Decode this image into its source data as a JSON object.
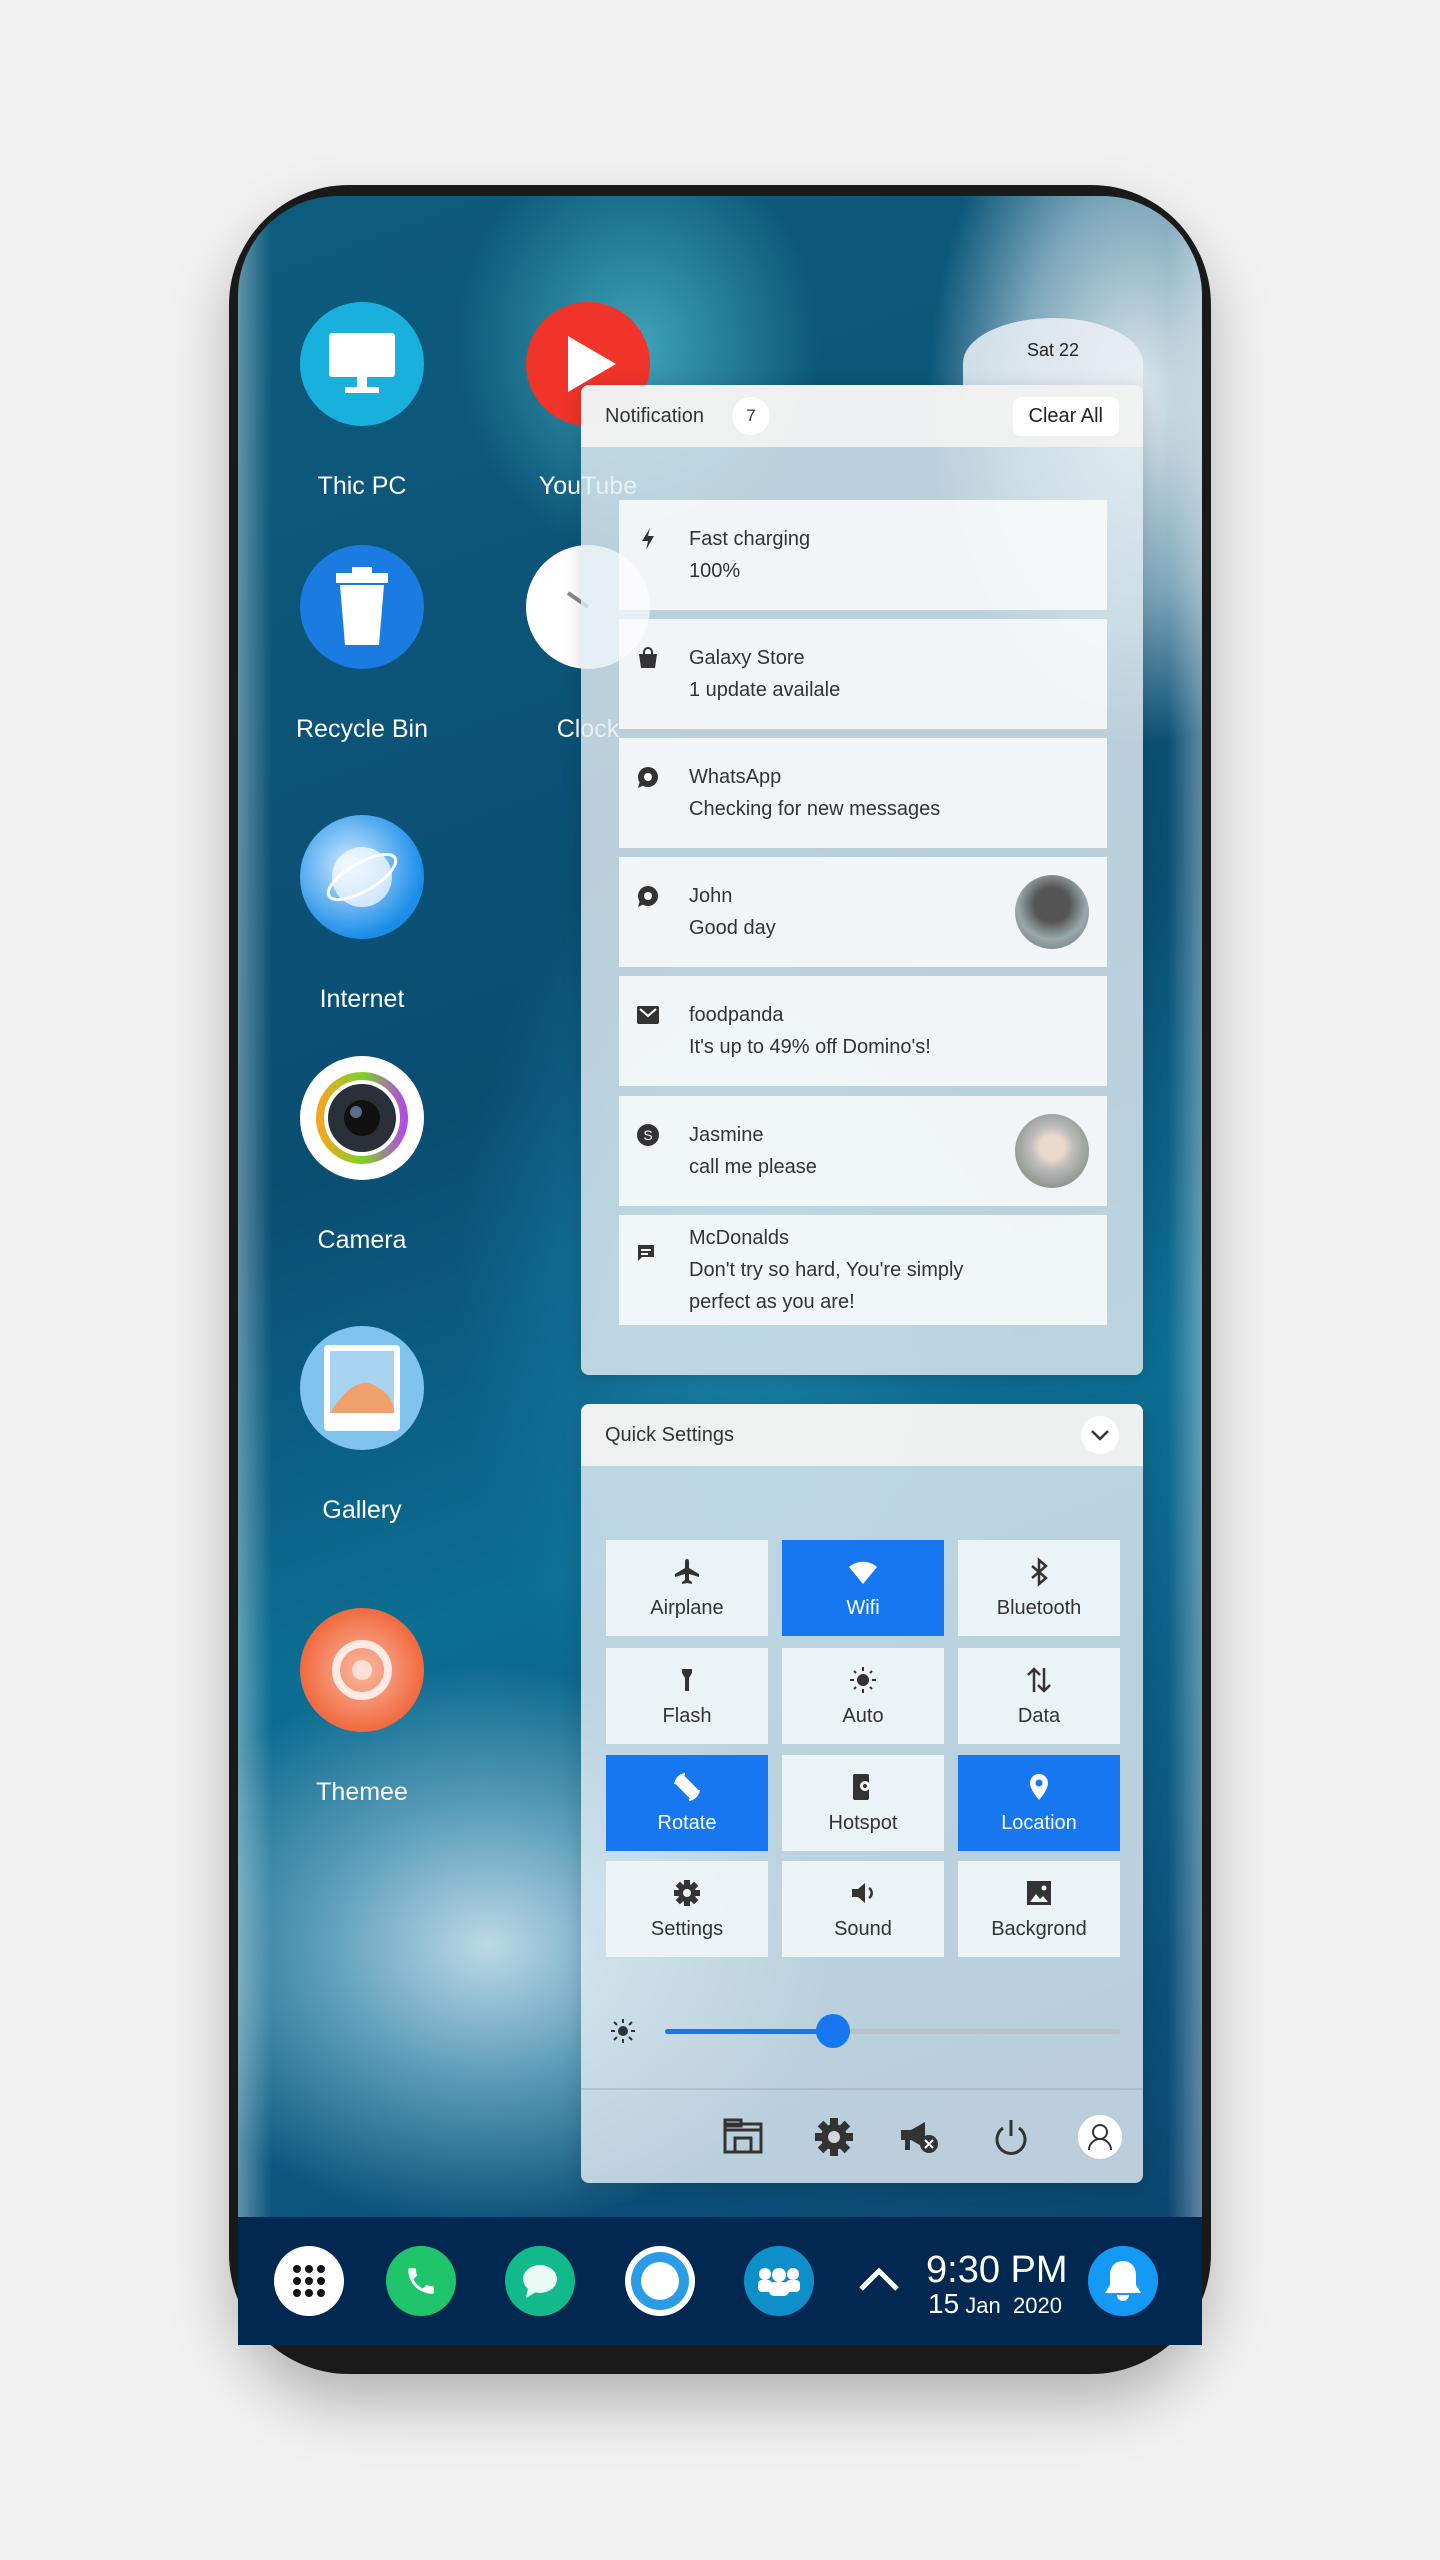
{
  "desktop": {
    "apps": [
      {
        "label": "Thic PC",
        "icon": "monitor-icon",
        "color": "#1ab0dd"
      },
      {
        "label": "YouTube",
        "icon": "play-icon",
        "color": "#f0342a"
      },
      {
        "label": "Recycle Bin",
        "icon": "trash-icon",
        "color": "#1a7be0"
      },
      {
        "label": "Clock",
        "icon": "clock-icon",
        "color": "#ffffff"
      },
      {
        "label": "Internet",
        "icon": "globe-icon",
        "color": "#1a8de8"
      },
      {
        "label": "Camera",
        "icon": "camera-icon",
        "color": "#ffffff"
      },
      {
        "label": "Gallery",
        "icon": "gallery-icon",
        "color": "#7fc3ef"
      },
      {
        "label": "Themee",
        "icon": "theme-icon",
        "color": "#f26a40"
      }
    ]
  },
  "date_widget": "Sat 22",
  "notifications": {
    "title": "Notification",
    "count": "7",
    "clear_label": "Clear All",
    "items": [
      {
        "icon": "bolt-icon",
        "title": "Fast charging",
        "body": "100%"
      },
      {
        "icon": "shopping-bag-icon",
        "title": "Galaxy Store",
        "body": "1 update availale"
      },
      {
        "icon": "whatsapp-icon",
        "title": "WhatsApp",
        "body": "Checking for new messages"
      },
      {
        "icon": "whatsapp-icon",
        "title": "John",
        "body": "Good day",
        "avatar": true
      },
      {
        "icon": "mail-icon",
        "title": "foodpanda",
        "body": "It's up to 49% off Domino's!"
      },
      {
        "icon": "skype-icon",
        "title": "Jasmine",
        "body": "call me please",
        "avatar": true
      },
      {
        "icon": "chat-icon",
        "title": "McDonalds",
        "body": "Don't try so hard, You're simply",
        "body2": "perfect as you are!"
      }
    ]
  },
  "quick_settings": {
    "title": "Quick Settings",
    "accent": "#1677f0",
    "tiles": [
      {
        "label": "Airplane",
        "icon": "airplane-icon",
        "on": false
      },
      {
        "label": "Wifi",
        "icon": "wifi-icon",
        "on": true
      },
      {
        "label": "Bluetooth",
        "icon": "bluetooth-icon",
        "on": false
      },
      {
        "label": "Flash",
        "icon": "flashlight-icon",
        "on": false
      },
      {
        "label": "Auto",
        "icon": "brightness-icon",
        "on": false
      },
      {
        "label": "Data",
        "icon": "data-arrows-icon",
        "on": false
      },
      {
        "label": "Rotate",
        "icon": "rotate-icon",
        "on": true
      },
      {
        "label": "Hotspot",
        "icon": "hotspot-icon",
        "on": false
      },
      {
        "label": "Location",
        "icon": "location-pin-icon",
        "on": true
      },
      {
        "label": "Settings",
        "icon": "gear-icon",
        "on": false
      },
      {
        "label": "Sound",
        "icon": "speaker-icon",
        "on": false
      },
      {
        "label": "Backgrond",
        "icon": "image-icon",
        "on": false
      }
    ],
    "brightness": 0.37,
    "footer_icons": [
      "file-explorer-icon",
      "gear-icon",
      "megaphone-mute-icon",
      "power-icon",
      "user-icon"
    ]
  },
  "taskbar": {
    "time": "9:30 PM",
    "day": "15",
    "month": "Jan",
    "year": "2020",
    "icons": [
      "app-grid-icon",
      "phone-icon",
      "messages-icon",
      "cortana-icon",
      "people-icon",
      "chevron-up-icon",
      "bell-icon"
    ]
  }
}
